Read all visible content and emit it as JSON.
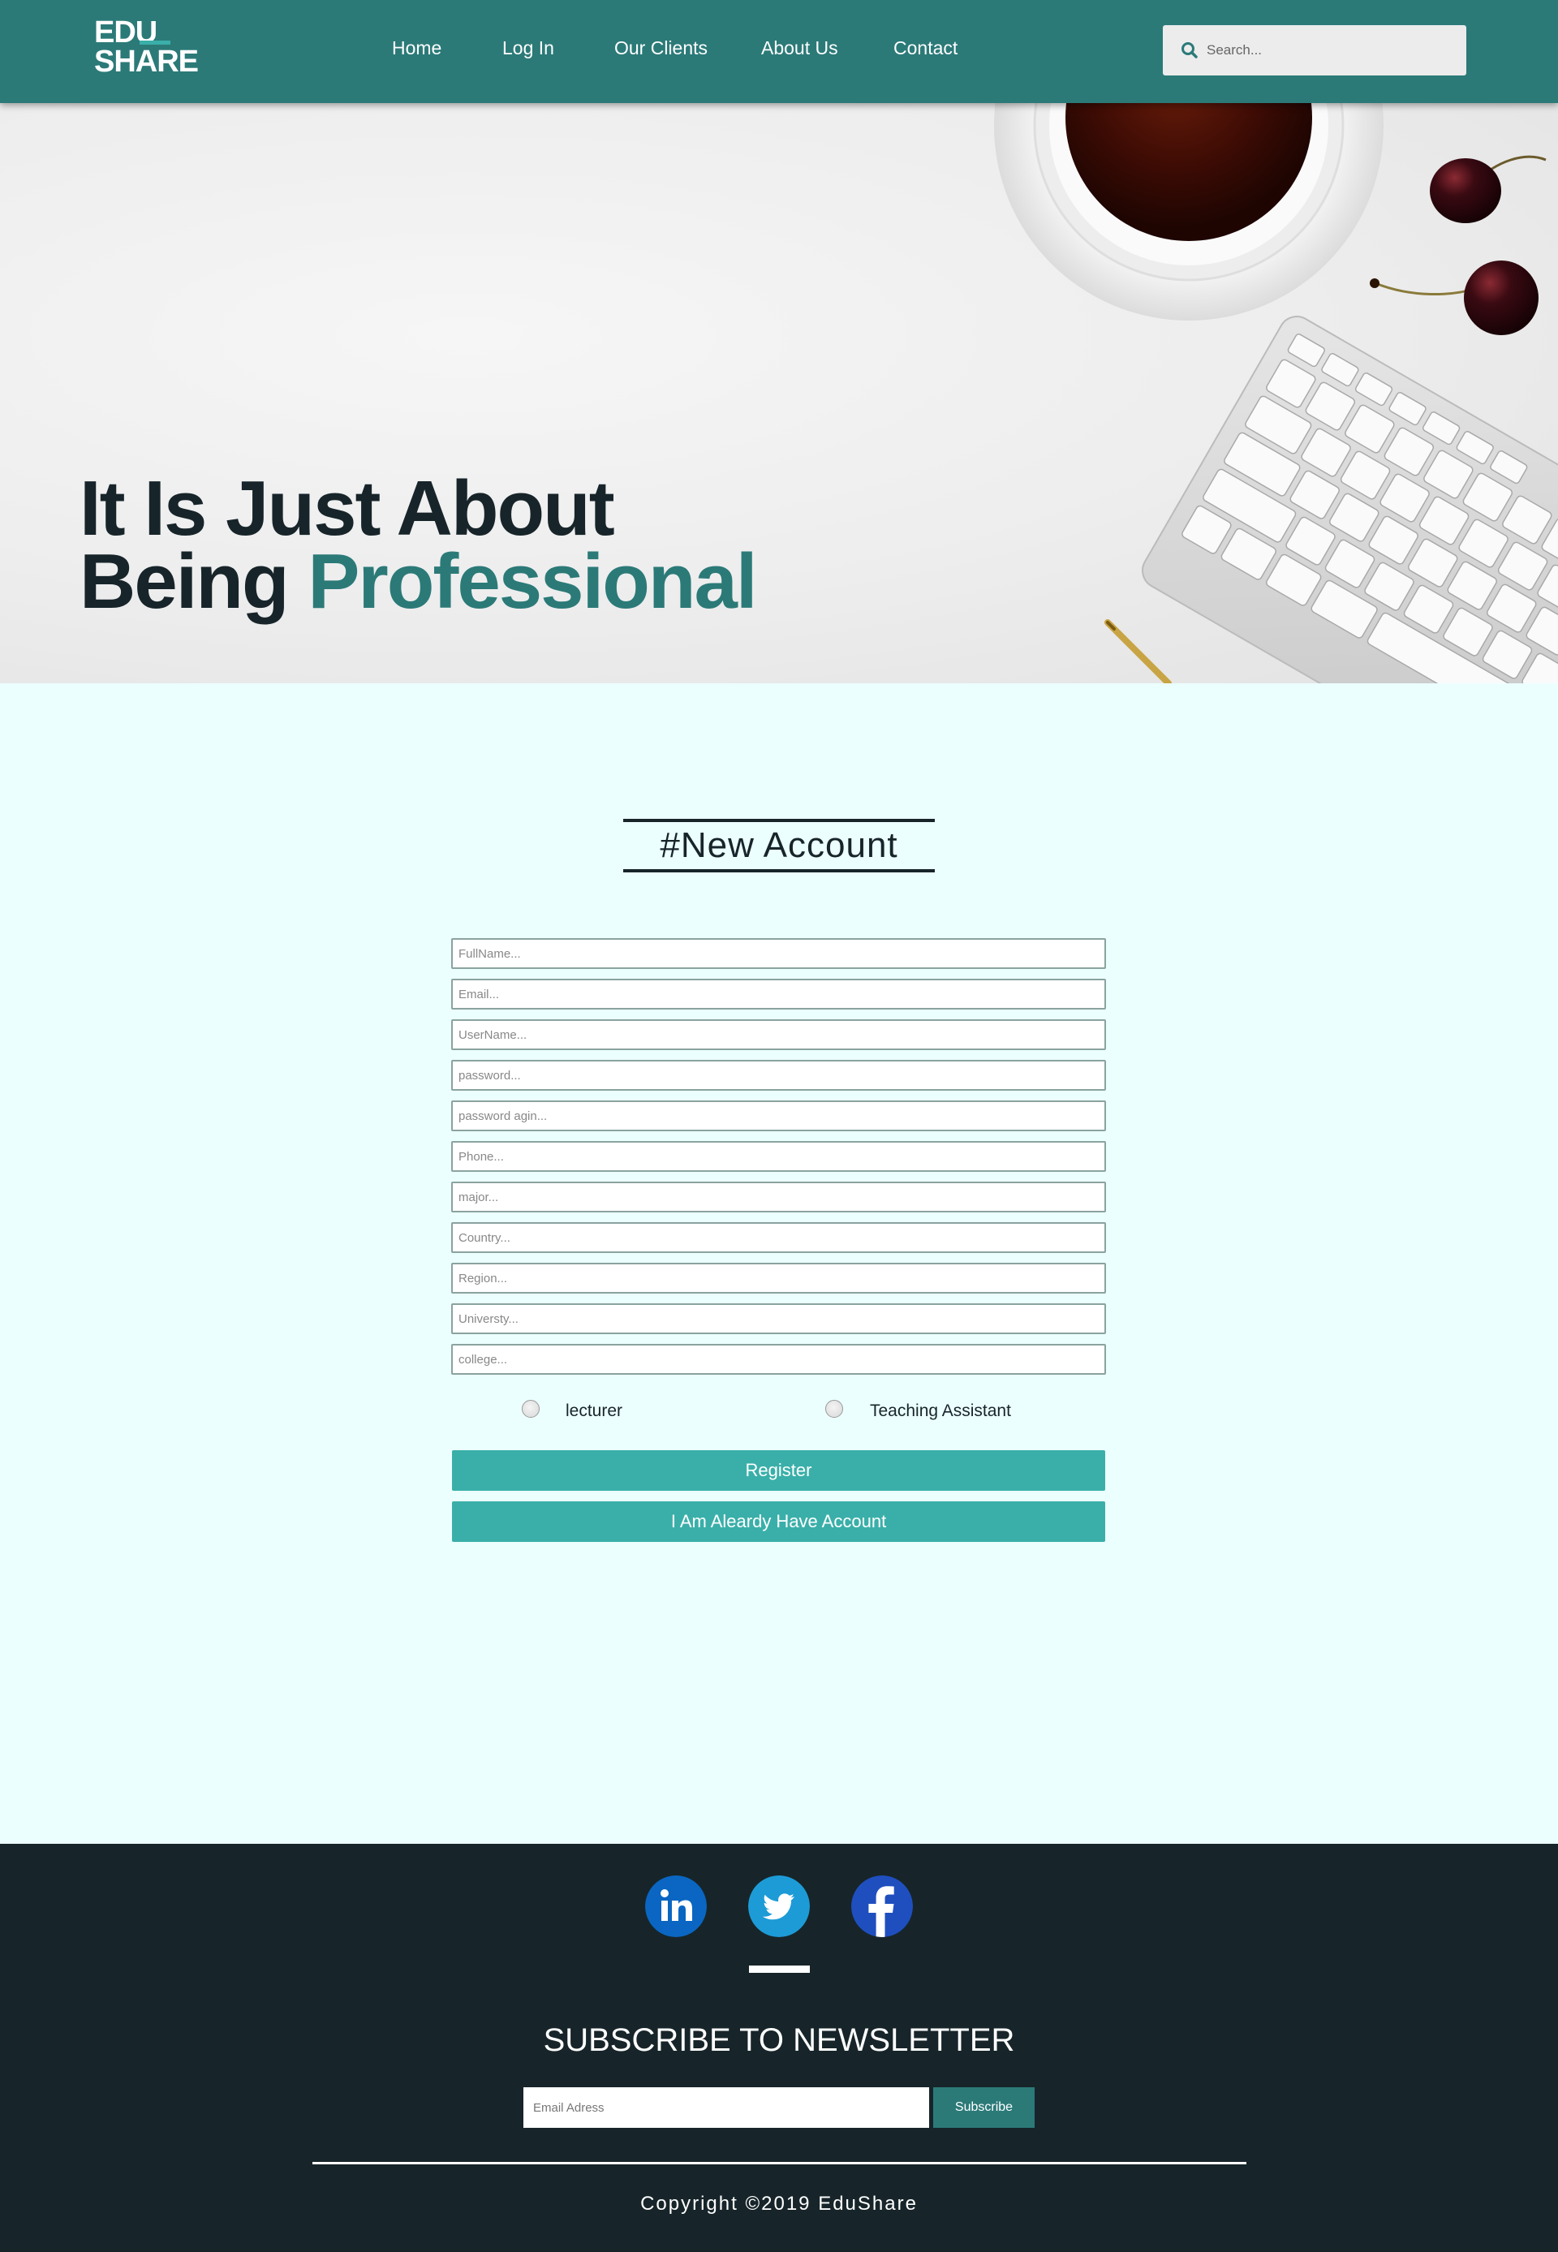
{
  "header": {
    "logo_line1": "EDU",
    "logo_line2": "SHARE",
    "nav": [
      "Home",
      "Log In",
      "Our Clients",
      "About Us",
      "Contact"
    ],
    "search_placeholder": "Search..."
  },
  "hero": {
    "line1": "It Is Just About",
    "line2_prefix": "Being ",
    "line2_accent": "Professional"
  },
  "form": {
    "title": "#New Account",
    "fields": [
      "FullName...",
      "Email...",
      "UserName...",
      "password...",
      "password agin...",
      "Phone...",
      "major...",
      "Country...",
      "Region...",
      "Universty...",
      "college..."
    ],
    "radio_options": [
      "lecturer",
      "Teaching Assistant"
    ],
    "register_label": "Register",
    "have_account_label": "I Am Aleardy Have Account"
  },
  "footer": {
    "socials": [
      "linkedin-icon",
      "twitter-icon",
      "facebook-icon"
    ],
    "newsletter_title": "SUBSCRIBE TO NEWSLETTER",
    "email_placeholder": "Email Adress",
    "subscribe_label": "Subscribe",
    "copyright": "Copyright ©2019 EduShare"
  },
  "colors": {
    "primary": "#2b7a78",
    "accent": "#3aafa9",
    "dark": "#17252a",
    "page_bg": "#ecffff"
  }
}
